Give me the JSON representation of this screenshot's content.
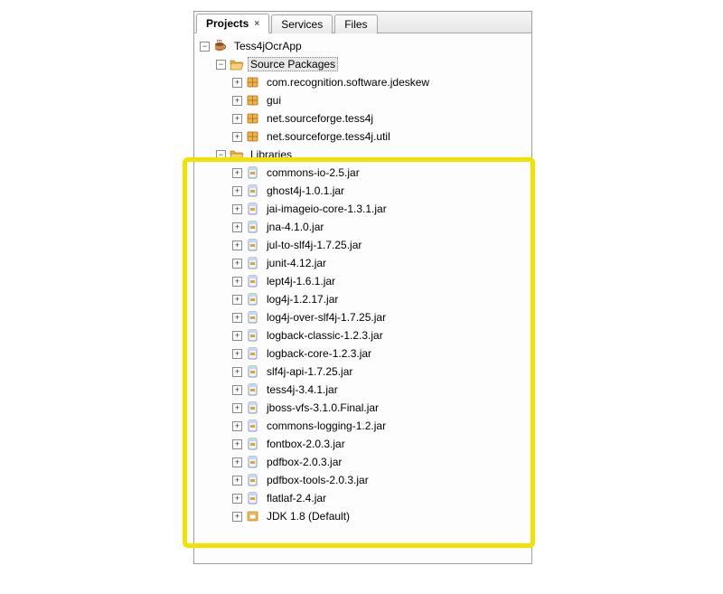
{
  "tabs": {
    "projects": "Projects",
    "services": "Services",
    "files": "Files"
  },
  "project": {
    "name": "Tess4jOcrApp",
    "sourcePackages": {
      "label": "Source Packages",
      "items": [
        "com.recognition.software.jdeskew",
        "gui",
        "net.sourceforge.tess4j",
        "net.sourceforge.tess4j.util"
      ]
    },
    "libraries": {
      "label": "Libraries",
      "jars": [
        "commons-io-2.5.jar",
        "ghost4j-1.0.1.jar",
        "jai-imageio-core-1.3.1.jar",
        "jna-4.1.0.jar",
        "jul-to-slf4j-1.7.25.jar",
        "junit-4.12.jar",
        "lept4j-1.6.1.jar",
        "log4j-1.2.17.jar",
        "log4j-over-slf4j-1.7.25.jar",
        "logback-classic-1.2.3.jar",
        "logback-core-1.2.3.jar",
        "slf4j-api-1.7.25.jar",
        "tess4j-3.4.1.jar",
        "jboss-vfs-3.1.0.Final.jar",
        "commons-logging-1.2.jar",
        "fontbox-2.0.3.jar",
        "pdfbox-2.0.3.jar",
        "pdfbox-tools-2.0.3.jar",
        "flatlaf-2.4.jar"
      ],
      "jdk": "JDK 1.8 (Default)"
    }
  },
  "glyph": {
    "plus": "+",
    "minus": "−",
    "close": "×"
  }
}
